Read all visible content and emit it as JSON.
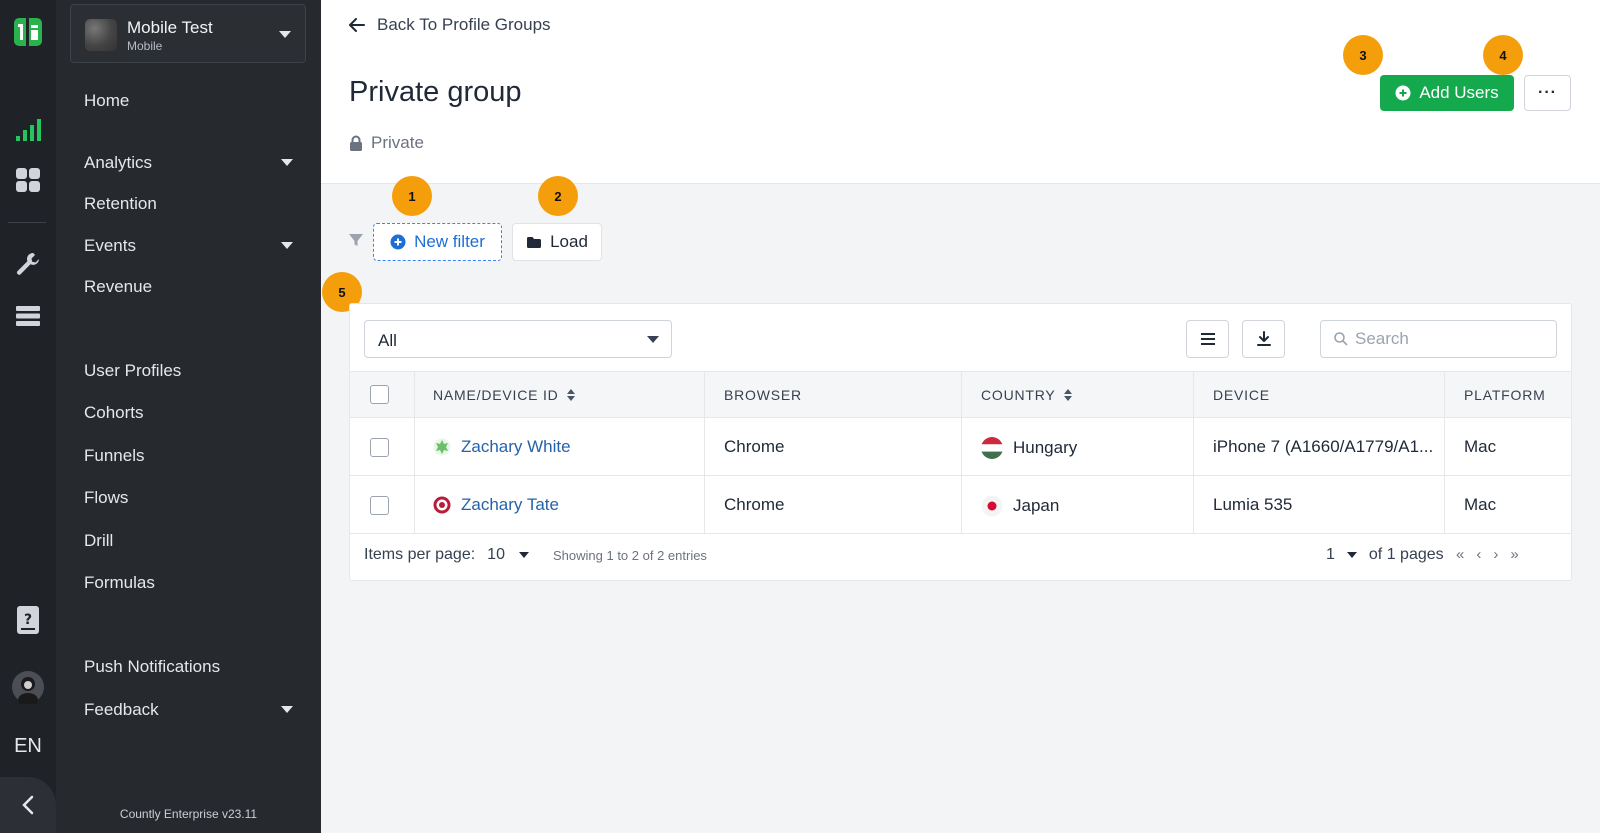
{
  "app": {
    "name": "Mobile Test",
    "type": "Mobile",
    "version": "Countly Enterprise v23.11",
    "language": "EN"
  },
  "colors": {
    "accent": "#14a94c",
    "link": "#2563a8",
    "badge": "#f59e0b",
    "sidebar": "#26292e"
  },
  "icons": {
    "rail": [
      "countly-logo-icon",
      "analytics-bars-icon",
      "dashboard-grid-icon",
      "wrench-icon",
      "database-icon",
      "help-book-icon",
      "user-avatar-icon",
      "chevron-left-icon"
    ]
  },
  "nav": {
    "items": [
      {
        "label": "Home",
        "dropdown": false
      },
      {
        "label": "Analytics",
        "dropdown": true
      },
      {
        "label": "Retention",
        "dropdown": false
      },
      {
        "label": "Events",
        "dropdown": true
      },
      {
        "label": "Revenue",
        "dropdown": false
      },
      {
        "label": "User Profiles",
        "dropdown": false
      },
      {
        "label": "Cohorts",
        "dropdown": false
      },
      {
        "label": "Funnels",
        "dropdown": false
      },
      {
        "label": "Flows",
        "dropdown": false
      },
      {
        "label": "Drill",
        "dropdown": false
      },
      {
        "label": "Formulas",
        "dropdown": false
      },
      {
        "label": "Push Notifications",
        "dropdown": false
      },
      {
        "label": "Feedback",
        "dropdown": true
      }
    ]
  },
  "header": {
    "back_label": "Back To Profile Groups",
    "title": "Private group",
    "privacy": "Private",
    "add_users_label": "Add Users",
    "more_label": "···"
  },
  "badges": [
    "1",
    "2",
    "3",
    "4",
    "5"
  ],
  "filters": {
    "new_filter_label": "New filter",
    "load_label": "Load"
  },
  "table": {
    "select_value": "All",
    "search_placeholder": "Search",
    "columns": [
      "NAME/DEVICE ID",
      "BROWSER",
      "COUNTRY",
      "DEVICE",
      "PLATFORM"
    ],
    "rows": [
      {
        "name": "Zachary White",
        "browser": "Chrome",
        "country": "Hungary",
        "device": "iPhone 7 (A1660/A1779/A1...",
        "platform": "Mac"
      },
      {
        "name": "Zachary Tate",
        "browser": "Chrome",
        "country": "Japan",
        "device": "Lumia 535",
        "platform": "Mac"
      }
    ],
    "pagination": {
      "items_per_page_label": "Items per page:",
      "items_per_page": "10",
      "showing": "Showing 1 to 2 of 2 entries",
      "page": "1",
      "of_pages": "of 1 pages"
    }
  }
}
